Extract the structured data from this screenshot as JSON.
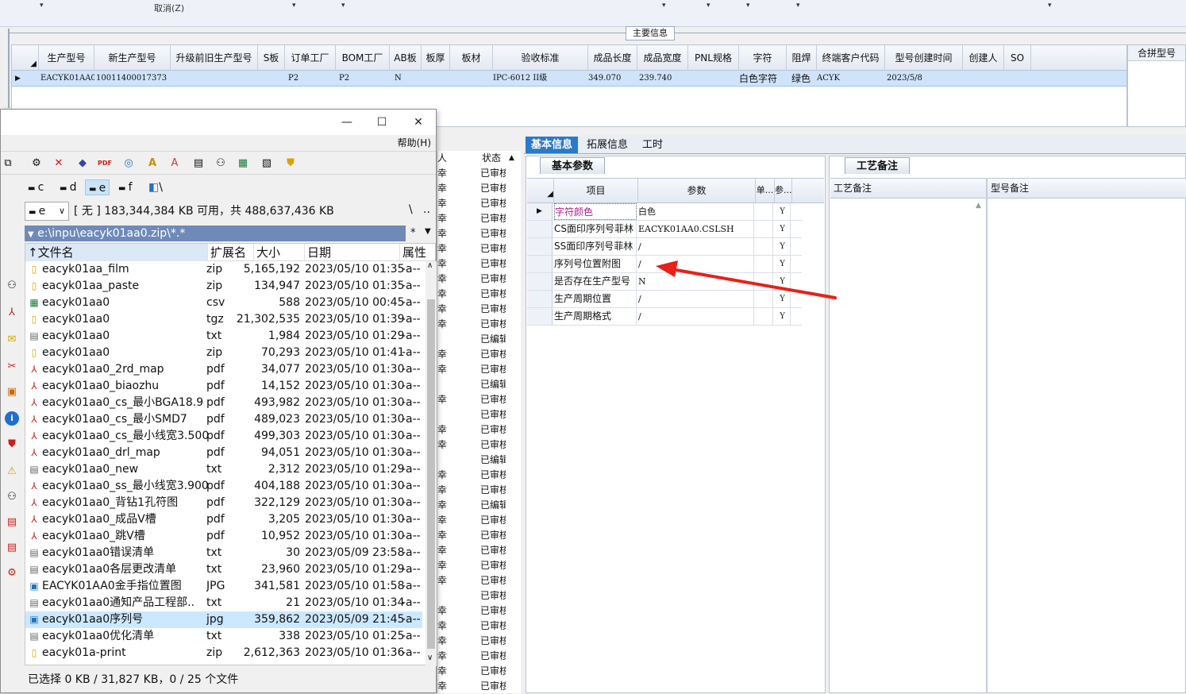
{
  "topbar": {
    "cancel_label": "取消(Z)"
  },
  "section_tab": "主要信息",
  "main_grid": {
    "headers": [
      "生产型号",
      "新生产型号",
      "升级前旧生产型号",
      "S板",
      "订单工厂",
      "BOM工厂",
      "AB板",
      "板厚",
      "板材",
      "验收标准",
      "成品长度",
      "成品宽度",
      "PNL规格",
      "字符",
      "阻焊",
      "终端客户代码",
      "型号创建时间",
      "创建人",
      "SO"
    ],
    "row": [
      "EACYK01AA0",
      "10011400017373",
      "",
      "",
      "P2",
      "P2",
      "N",
      "",
      "",
      "IPC-6012 II级",
      "349.070",
      "239.740",
      "",
      "白色字符",
      "绿色",
      "ACYK",
      "2023/5/8",
      "",
      ""
    ],
    "merge_header": "合拼型号"
  },
  "right_tabs": [
    "基本信息",
    "拓展信息",
    "工时"
  ],
  "param_panel": {
    "subtab": "基本参数",
    "headers": [
      "项目",
      "参数",
      "单...",
      "参..."
    ],
    "rows": [
      {
        "item": "字符颜色",
        "value": "白色",
        "unit": "",
        "flag": "Y"
      },
      {
        "item": "CS面印序列号菲林",
        "value": "EACYK01AA0.CSLSH",
        "unit": "",
        "flag": "Y"
      },
      {
        "item": "SS面印序列号菲林",
        "value": "/",
        "unit": "",
        "flag": "Y"
      },
      {
        "item": "序列号位置附图",
        "value": "/",
        "unit": "",
        "flag": "Y"
      },
      {
        "item": "是否存在生产型号",
        "value": "N",
        "unit": "",
        "flag": "Y"
      },
      {
        "item": "生产周期位置",
        "value": "/",
        "unit": "",
        "flag": "Y"
      },
      {
        "item": "生产周期格式",
        "value": "/",
        "unit": "",
        "flag": "Y"
      }
    ]
  },
  "process_panel": {
    "subtab": "工艺备注",
    "headers": [
      "工艺备注",
      "型号备注"
    ]
  },
  "status_column": {
    "headers": [
      "人",
      "状态"
    ],
    "left_chars": [
      "幸",
      "幸",
      "幸",
      "幸",
      "幸",
      "幸",
      "幸",
      "幸",
      "幸",
      "幸",
      "幸",
      "",
      "幸",
      "幸",
      "",
      "幸",
      "",
      "幸",
      "幸",
      "",
      "幸",
      "幸",
      "幸",
      "幸",
      "幸",
      "幸",
      "幸",
      "幸",
      "",
      "幸",
      "幸",
      "幸",
      "幸",
      "幸",
      "幸",
      "幸",
      "幸",
      "幸"
    ],
    "statuses": [
      "已审核",
      "已审核",
      "已审核",
      "已审核",
      "已审核",
      "已审核",
      "已审核",
      "已审核",
      "已审核",
      "已审核",
      "已审核",
      "已编辑",
      "已审核",
      "已审核",
      "已编辑",
      "已审核",
      "已审核",
      "已审核",
      "已审核",
      "已编辑",
      "已审核",
      "已审核",
      "已编辑",
      "已审核",
      "已审核",
      "已审核",
      "已审核",
      "已审核",
      "已审核",
      "已审核",
      "已审核",
      "已审核",
      "已审核",
      "已审核",
      "已审核",
      "已审核",
      "已审核",
      "已审核"
    ]
  },
  "file_manager": {
    "help": "帮助(H)",
    "drives": [
      "c",
      "d",
      "e",
      "f",
      "\\"
    ],
    "drive_box": "e",
    "free_space": "[ 无 ]  183,344,384 KB 可用，共 488,637,436 KB",
    "path": "e:\\inpu\\eacyk01aa0.zip\\*.*",
    "path_suffix_1": "\\",
    "path_suffix_2": "..",
    "path_suffix_3": "*",
    "headers": [
      "↑文件名",
      "扩展名",
      "大小",
      "日期",
      "属性"
    ],
    "files": [
      {
        "icon": "zip",
        "name": "eacyk01aa_film",
        "ext": "zip",
        "size": "5,165,192",
        "date": "2023/05/10 01:35",
        "attr": "-a--"
      },
      {
        "icon": "zip",
        "name": "eacyk01aa_paste",
        "ext": "zip",
        "size": "134,947",
        "date": "2023/05/10 01:35",
        "attr": "-a--"
      },
      {
        "icon": "csv",
        "name": "eacyk01aa0",
        "ext": "csv",
        "size": "588",
        "date": "2023/05/10 00:45",
        "attr": "-a--"
      },
      {
        "icon": "zip",
        "name": "eacyk01aa0",
        "ext": "tgz",
        "size": "21,302,535",
        "date": "2023/05/10 01:39",
        "attr": "-a--"
      },
      {
        "icon": "txt",
        "name": "eacyk01aa0",
        "ext": "txt",
        "size": "1,984",
        "date": "2023/05/10 01:29",
        "attr": "-a--"
      },
      {
        "icon": "zip",
        "name": "eacyk01aa0",
        "ext": "zip",
        "size": "70,293",
        "date": "2023/05/10 01:41",
        "attr": "-a--"
      },
      {
        "icon": "pdf",
        "name": "eacyk01aa0_2rd_map",
        "ext": "pdf",
        "size": "34,077",
        "date": "2023/05/10 01:30",
        "attr": "-a--"
      },
      {
        "icon": "pdf",
        "name": "eacyk01aa0_biaozhu",
        "ext": "pdf",
        "size": "14,152",
        "date": "2023/05/10 01:30",
        "attr": "-a--"
      },
      {
        "icon": "pdf",
        "name": "eacyk01aa0_cs_最小BGA18.9",
        "ext": "pdf",
        "size": "493,982",
        "date": "2023/05/10 01:30",
        "attr": "-a--"
      },
      {
        "icon": "pdf",
        "name": "eacyk01aa0_cs_最小SMD7",
        "ext": "pdf",
        "size": "489,023",
        "date": "2023/05/10 01:30",
        "attr": "-a--"
      },
      {
        "icon": "pdf",
        "name": "eacyk01aa0_cs_最小线宽3.500",
        "ext": "pdf",
        "size": "499,303",
        "date": "2023/05/10 01:30",
        "attr": "-a--"
      },
      {
        "icon": "pdf",
        "name": "eacyk01aa0_drl_map",
        "ext": "pdf",
        "size": "94,051",
        "date": "2023/05/10 01:30",
        "attr": "-a--"
      },
      {
        "icon": "txt",
        "name": "eacyk01aa0_new",
        "ext": "txt",
        "size": "2,312",
        "date": "2023/05/10 01:29",
        "attr": "-a--"
      },
      {
        "icon": "pdf",
        "name": "eacyk01aa0_ss_最小线宽3.900",
        "ext": "pdf",
        "size": "404,188",
        "date": "2023/05/10 01:30",
        "attr": "-a--"
      },
      {
        "icon": "pdf",
        "name": "eacyk01aa0_背钻1孔符图",
        "ext": "pdf",
        "size": "322,129",
        "date": "2023/05/10 01:30",
        "attr": "-a--"
      },
      {
        "icon": "pdf",
        "name": "eacyk01aa0_成品V槽",
        "ext": "pdf",
        "size": "3,205",
        "date": "2023/05/10 01:30",
        "attr": "-a--"
      },
      {
        "icon": "pdf",
        "name": "eacyk01aa0_跳V槽",
        "ext": "pdf",
        "size": "10,952",
        "date": "2023/05/10 01:30",
        "attr": "-a--"
      },
      {
        "icon": "txt",
        "name": "eacyk01aa0错误清单",
        "ext": "txt",
        "size": "30",
        "date": "2023/05/09 23:58",
        "attr": "-a--"
      },
      {
        "icon": "txt",
        "name": "eacyk01aa0各层更改清单",
        "ext": "txt",
        "size": "23,960",
        "date": "2023/05/10 01:29",
        "attr": "-a--"
      },
      {
        "icon": "jpg",
        "name": "EACYK01AA0金手指位置图",
        "ext": "JPG",
        "size": "341,581",
        "date": "2023/05/10 01:58",
        "attr": "-a--"
      },
      {
        "icon": "txt",
        "name": "eacyk01aa0通知产品工程部..",
        "ext": "txt",
        "size": "21",
        "date": "2023/05/10 01:34",
        "attr": "-a--"
      },
      {
        "icon": "jpg",
        "name": "eacyk01aa0序列号",
        "ext": "jpg",
        "size": "359,862",
        "date": "2023/05/09 21:45",
        "attr": "-a--"
      },
      {
        "icon": "txt",
        "name": "eacyk01aa0优化清单",
        "ext": "txt",
        "size": "338",
        "date": "2023/05/10 01:25",
        "attr": "-a--"
      },
      {
        "icon": "zip",
        "name": "eacyk01a-print",
        "ext": "zip",
        "size": "2,612,363",
        "date": "2023/05/10 01:36",
        "attr": "-a--"
      }
    ],
    "status": "已选择 0 KB / 31,827 KB，0 / 25 个文件"
  },
  "colors": {
    "tab_active": "#2b79c9",
    "row_selected": "#cfe3fb",
    "arrow": "#e8201a",
    "param_highlight": "#b0208a"
  }
}
